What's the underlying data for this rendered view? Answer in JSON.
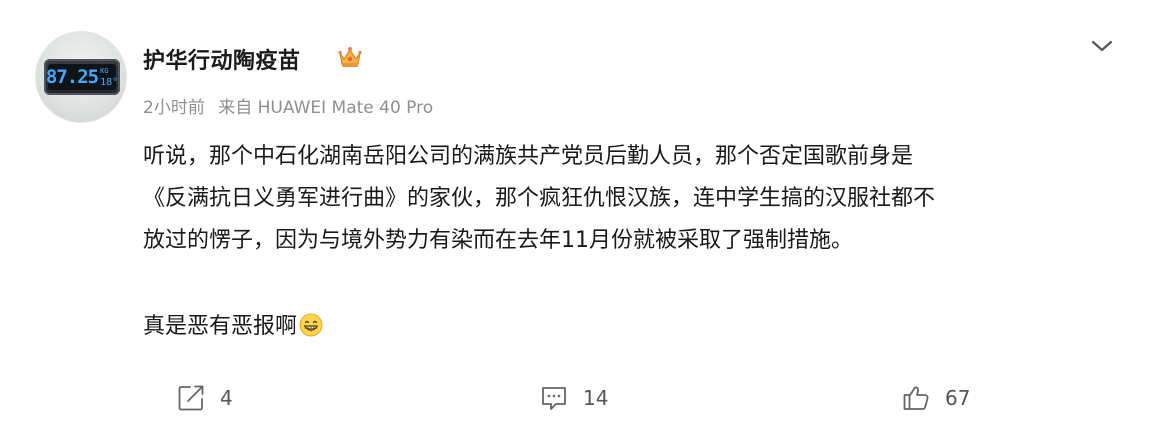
{
  "post": {
    "avatar": {
      "display": "87.25",
      "side_unit": "KG",
      "side_temp": "18°"
    },
    "username": "护华行动陶疫苗",
    "badge_icon": "crown-icon",
    "meta": {
      "time": "2小时前",
      "source": "来自 HUAWEI Mate 40 Pro"
    },
    "more_icon": "chevron-down-icon",
    "content": {
      "line1": "听说，那个中石化湖南岳阳公司的满族共产党员后勤人员，那个否定国歌前身是",
      "line2": "《反满抗日义勇军进行曲》的家伙，那个疯狂仇恨汉族，连中学生搞的汉服社都不",
      "line3": "放过的愣子，因为与境外势力有染而在去年11月份就被采取了强制措施。",
      "line4": "真是恶有恶报啊",
      "emoji": "grin-icon"
    },
    "actions": {
      "share": {
        "icon": "share-icon",
        "count": "4"
      },
      "comment": {
        "icon": "comment-icon",
        "count": "14"
      },
      "like": {
        "icon": "thumbs-up-icon",
        "count": "67"
      }
    },
    "colors": {
      "text": "#1a1a1a",
      "meta": "#8f8f8f",
      "icon": "#666666"
    }
  }
}
